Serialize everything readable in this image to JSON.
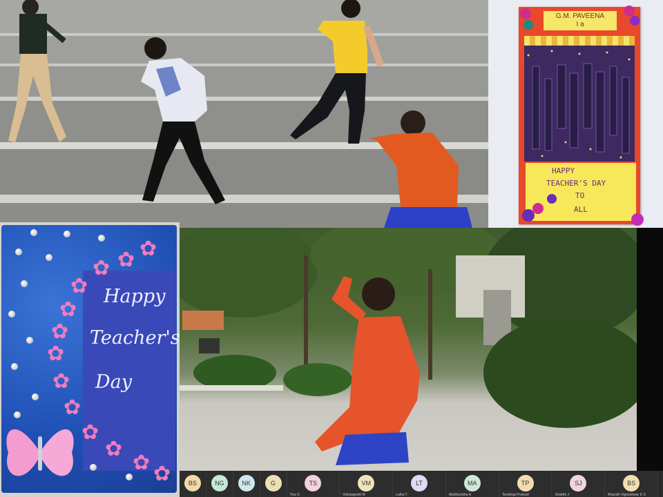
{
  "card1": {
    "name_line1": "G.M. PAVEENA",
    "name_line2": "I a",
    "message_lines": [
      "HAPPY",
      "TEACHER'S DAY",
      "TO",
      "ALL"
    ]
  },
  "card2": {
    "line1": "Happy",
    "line2": "Teacher's",
    "line3": "Day"
  },
  "participants": [
    {
      "initials": "BS",
      "name": "",
      "color": "#f3d9a8"
    },
    {
      "initials": "NG",
      "name": "",
      "color": "#c7e8d6"
    },
    {
      "initials": "NK",
      "name": "",
      "color": "#cfe6ee"
    },
    {
      "initials": "G",
      "name": "",
      "color": "#eee0b5"
    },
    {
      "initials": "TS",
      "name": "Tina S",
      "color": "#f3d2dc"
    },
    {
      "initials": "VM",
      "name": "Vishwajeeth M",
      "color": "#f1e2b9"
    },
    {
      "initials": "LT",
      "name": "Latha T",
      "color": "#dcdcf2"
    },
    {
      "initials": "MA",
      "name": "Madhumitha A",
      "color": "#cfe8d8"
    },
    {
      "initials": "TP",
      "name": "Tanishqa Pramod",
      "color": "#f3dcb0"
    },
    {
      "initials": "SJ",
      "name": "Shakthi J",
      "color": "#f0d6de"
    },
    {
      "initials": "BS",
      "name": "Bharath Vigneshwar K S",
      "color": "#f2deb0"
    }
  ]
}
